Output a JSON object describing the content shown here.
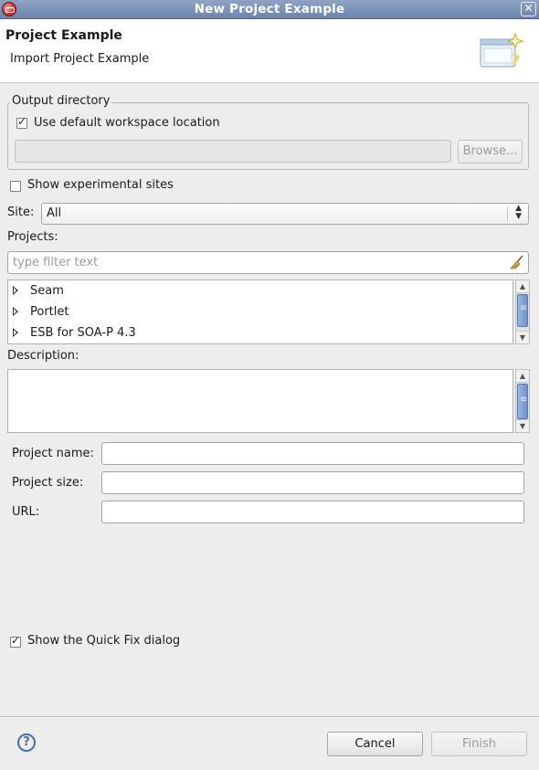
{
  "window": {
    "title": "New Project Example"
  },
  "header": {
    "title": "Project Example",
    "subtitle": "Import Project Example"
  },
  "output_directory": {
    "legend": "Output directory",
    "use_default_label": "Use default workspace location",
    "use_default_checked": true,
    "location_value": "",
    "browse_label": "Browse..."
  },
  "show_experimental": {
    "label": "Show experimental sites",
    "checked": false
  },
  "site": {
    "label": "Site:",
    "selected": "All"
  },
  "projects": {
    "label": "Projects:",
    "filter_placeholder": "type filter text",
    "items": [
      {
        "label": "Seam"
      },
      {
        "label": "Portlet"
      },
      {
        "label": "ESB for SOA-P 4.3"
      }
    ]
  },
  "description": {
    "label": "Description:",
    "value": ""
  },
  "fields": {
    "project_name_label": "Project name:",
    "project_name_value": "",
    "project_size_label": "Project size:",
    "project_size_value": "",
    "url_label": "URL:",
    "url_value": ""
  },
  "quick_fix": {
    "label": "Show the Quick Fix dialog",
    "checked": true
  },
  "buttons": {
    "cancel": "Cancel",
    "finish": "Finish",
    "help_glyph": "?"
  },
  "icons": {
    "app": "eclipse-app-icon",
    "close": "close-icon",
    "wizard": "wizard-banner-icon",
    "clear_filter": "broom-icon",
    "help": "help-icon"
  },
  "colors": {
    "accent": "#6d84ad",
    "scroll_thumb": "#6f93cb"
  }
}
